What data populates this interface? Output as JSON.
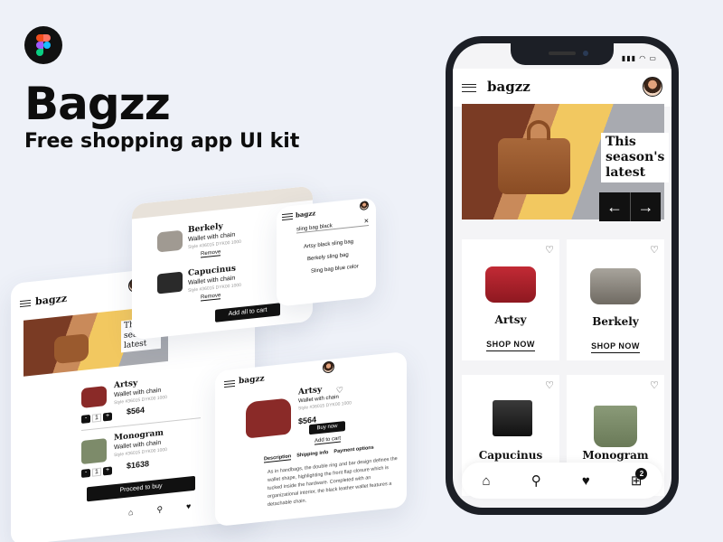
{
  "brand": {
    "title": "Bagzz",
    "subtitle": "Free shopping app UI kit"
  },
  "app": {
    "logo": "bagzz",
    "hero_text": [
      "This",
      "season's",
      "latest"
    ],
    "hero_prev": "←",
    "hero_next": "→",
    "products": [
      {
        "name": "Artsy",
        "cta": "SHOP NOW"
      },
      {
        "name": "Berkely",
        "cta": "SHOP NOW"
      },
      {
        "name": "Capucinus",
        "cta": ""
      },
      {
        "name": "Monogram",
        "cta": ""
      }
    ],
    "cart_count": "2"
  },
  "cart_screen": {
    "items": [
      {
        "name": "Artsy",
        "desc": "Wallet with chain",
        "style": "Style #36015 DYK00 1000",
        "price": "$564",
        "qty": "1"
      },
      {
        "name": "Monogram",
        "desc": "Wallet with chain",
        "style": "Style #36015 DYK00 1000",
        "price": "$1638",
        "qty": "1"
      }
    ],
    "minus": "-",
    "plus": "+",
    "proceed": "Proceed to buy"
  },
  "saved_screen": {
    "items": [
      {
        "name": "Berkely",
        "desc": "Wallet with chain",
        "style": "Style #36015 DYK00 1000",
        "remove": "Remove"
      },
      {
        "name": "Capucinus",
        "desc": "Wallet with chain",
        "style": "Style #36015 DYK00 1000",
        "remove": "Remove"
      }
    ],
    "add_all": "Add all to cart"
  },
  "search_screen": {
    "query": "sling bag black",
    "close": "×",
    "suggestions": [
      "Artsy black sling bag",
      "Berkely sling bag",
      "Sling bag blue color"
    ]
  },
  "detail_screen": {
    "name": "Artsy",
    "desc": "Wallet with chain",
    "style": "Style #36015 DYK00 1000",
    "price": "$564",
    "buy": "Buy now",
    "add": "Add to cart",
    "tabs": [
      "Description",
      "Shipping info",
      "Payment options"
    ],
    "body": "As in handbags, the double ring and bar design defines the wallet shape, highlighting the front flap closure which is tucked inside the hardware. Completed with an organizational interior, the black leather wallet features a detachable chain."
  },
  "colors": {
    "accent": "#111111",
    "bg": "#eef1f8",
    "phone": "#1c1f26"
  }
}
